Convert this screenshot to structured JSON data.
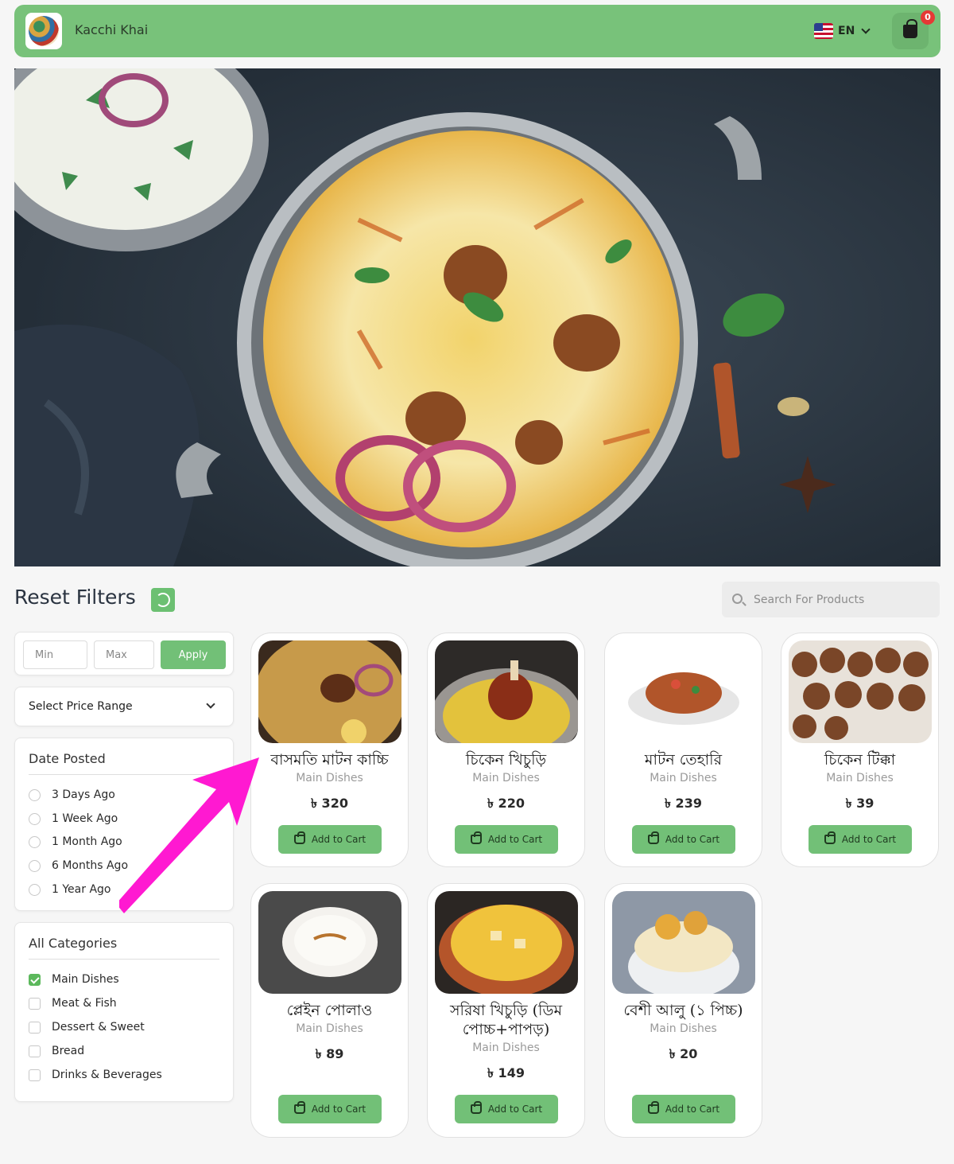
{
  "header": {
    "brand": "Kacchi Khai",
    "language": "EN",
    "flag_icon": "us-flag-icon",
    "cart_icon": "shopping-bag-icon",
    "cart_count": "0"
  },
  "hero": {
    "image": "kacchi-biryani-pot-photo"
  },
  "filters": {
    "reset_label": "Reset Filters",
    "reset_icon": "refresh-icon",
    "search_placeholder": "Search For Products",
    "min_placeholder": "Min",
    "max_placeholder": "Max",
    "apply_label": "Apply",
    "price_range_label": "Select Price Range",
    "date_title": "Date Posted",
    "date_options": [
      "3 Days Ago",
      "1 Week Ago",
      "1 Month Ago",
      "6 Months Ago",
      "1 Year Ago"
    ],
    "category_title": "All Categories",
    "categories": [
      {
        "label": "Main Dishes",
        "checked": true
      },
      {
        "label": "Meat & Fish",
        "checked": false
      },
      {
        "label": "Dessert & Sweet",
        "checked": false
      },
      {
        "label": "Bread",
        "checked": false
      },
      {
        "label": "Drinks & Beverages",
        "checked": false
      }
    ]
  },
  "products": [
    {
      "name": "বাসমতি মাটন কাচ্চি",
      "category": "Main Dishes",
      "price": "৳ 320",
      "button": "Add to Cart"
    },
    {
      "name": "চিকেন খিচুড়ি",
      "category": "Main Dishes",
      "price": "৳ 220",
      "button": "Add to Cart"
    },
    {
      "name": "মাটন তেহারি",
      "category": "Main Dishes",
      "price": "৳ 239",
      "button": "Add to Cart"
    },
    {
      "name": "চিকেন টিক্কা",
      "category": "Main Dishes",
      "price": "৳ 39",
      "button": "Add to Cart"
    },
    {
      "name": "প্লেইন পোলাও",
      "category": "Main Dishes",
      "price": "৳ 89",
      "button": "Add to Cart"
    },
    {
      "name": "সরিষা খিচুড়ি (ডিম পোচ্চ+পাপড়)",
      "category": "Main Dishes",
      "price": "৳ 149",
      "button": "Add to Cart"
    },
    {
      "name": "বেশী আলু (১ পিচ্চ)",
      "category": "Main Dishes",
      "price": "৳ 20",
      "button": "Add to Cart"
    }
  ],
  "colors": {
    "accent": "#78c27a",
    "button": "#72c077",
    "badge": "#e53935",
    "annotation_arrow": "#ff19d1"
  }
}
